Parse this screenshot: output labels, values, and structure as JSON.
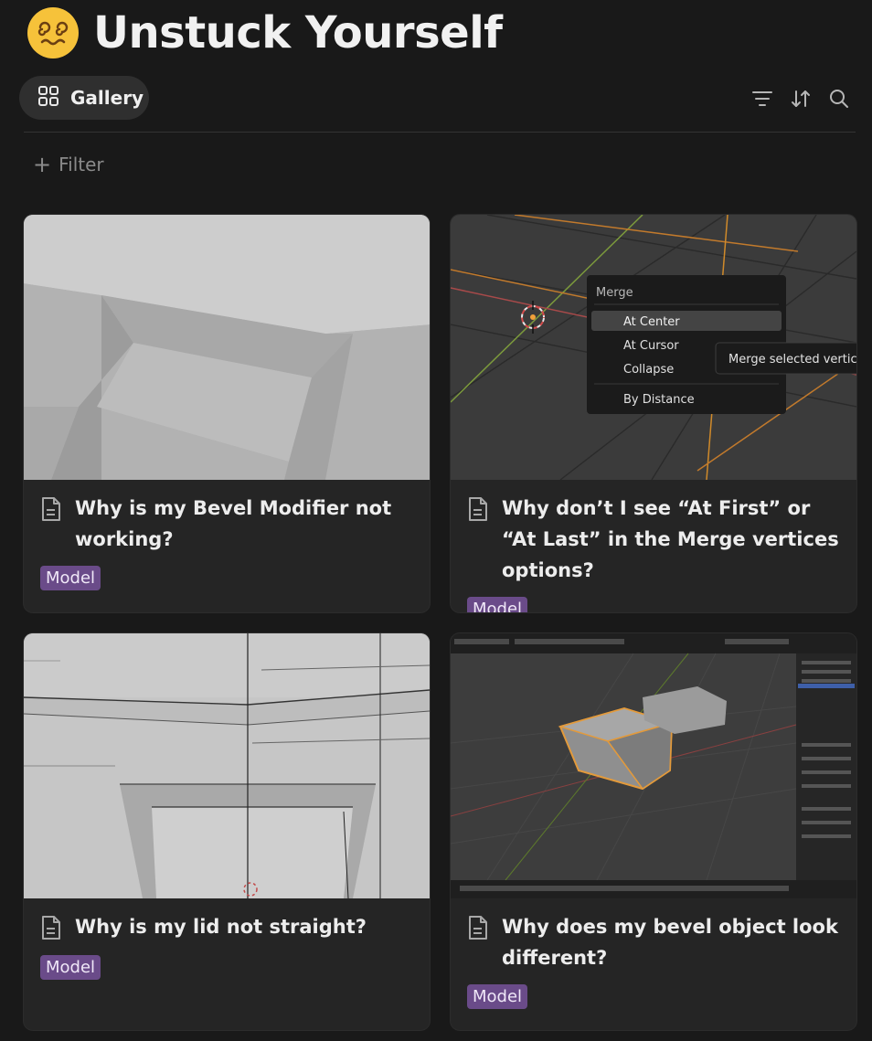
{
  "page": {
    "title": "Unstuck Yourself",
    "icon": "dizzy-face-emoji"
  },
  "view": {
    "label": "Gallery",
    "icon": "gallery-grid-icon"
  },
  "toolbar": {
    "icons": [
      "filter-lines-icon",
      "sort-arrows-icon",
      "search-icon"
    ]
  },
  "filter": {
    "label": "Filter"
  },
  "menu": {
    "title": "Merge",
    "items": [
      "At Center",
      "At Cursor",
      "Collapse",
      "By Distance"
    ],
    "tooltip": "Merge selected vertices"
  },
  "cards": [
    {
      "title": "Why is my Bevel Modifier not working?",
      "tag": "Model"
    },
    {
      "title": "Why don’t I see “At First” or “At Last” in the Merge vertices options?",
      "tag": "Model"
    },
    {
      "title": "Why is my lid not straight?",
      "tag": "Model"
    },
    {
      "title": "Why does my bevel object look different?",
      "tag": "Model"
    }
  ],
  "colors": {
    "background": "#191919",
    "card": "#252525",
    "tag": "#6a4b89",
    "accent_orange": "#e39a3b"
  }
}
